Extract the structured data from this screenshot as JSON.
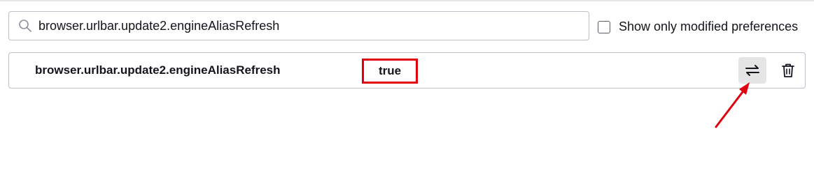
{
  "search": {
    "value": "browser.urlbar.update2.engineAliasRefresh",
    "icon": "search-icon"
  },
  "filter": {
    "checkbox_label": "Show only modified preferences",
    "checked": false
  },
  "preference": {
    "name": "browser.urlbar.update2.engineAliasRefresh",
    "value": "true",
    "toggle_icon": "toggle-arrows-icon",
    "delete_icon": "trash-icon"
  },
  "annotation": {
    "highlight_color": "#e0000d",
    "arrow_color": "#e0000d"
  }
}
